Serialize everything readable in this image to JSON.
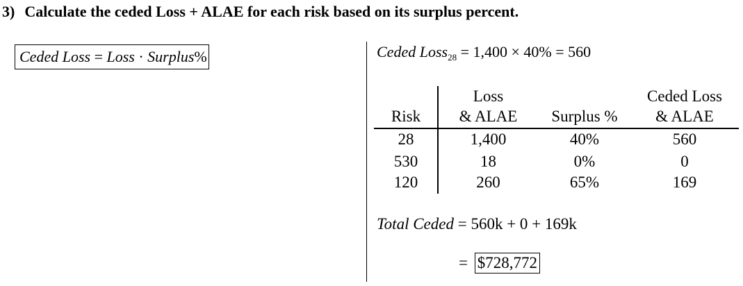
{
  "heading": {
    "number": "3)",
    "text": "Calculate the ceded Loss + ALAE for each risk based on its surplus percent."
  },
  "formula": {
    "lhs": "Ceded Loss",
    "equals": " = ",
    "term1": "Loss",
    "dot": " · ",
    "term2": "Surplus",
    "pct": "%"
  },
  "example_calc": {
    "lhs": "Ceded Loss",
    "subscript": "28",
    "rhs": " = 1,400 × 40% = 560"
  },
  "table": {
    "headers": [
      {
        "line1": "",
        "line2": "Risk"
      },
      {
        "line1": "Loss",
        "line2": "& ALAE"
      },
      {
        "line1": "",
        "line2": "Surplus %"
      },
      {
        "line1": "Ceded Loss",
        "line2": "& ALAE"
      }
    ],
    "rows": [
      [
        "28",
        "1,400",
        "40%",
        "560"
      ],
      [
        "530",
        "18",
        "0%",
        "0"
      ],
      [
        "120",
        "260",
        "65%",
        "169"
      ]
    ]
  },
  "total": {
    "label": "Total Ceded",
    "rhs": " = 560k + 0 + 169k"
  },
  "answer": {
    "equals": "= ",
    "value": "$728,772"
  }
}
